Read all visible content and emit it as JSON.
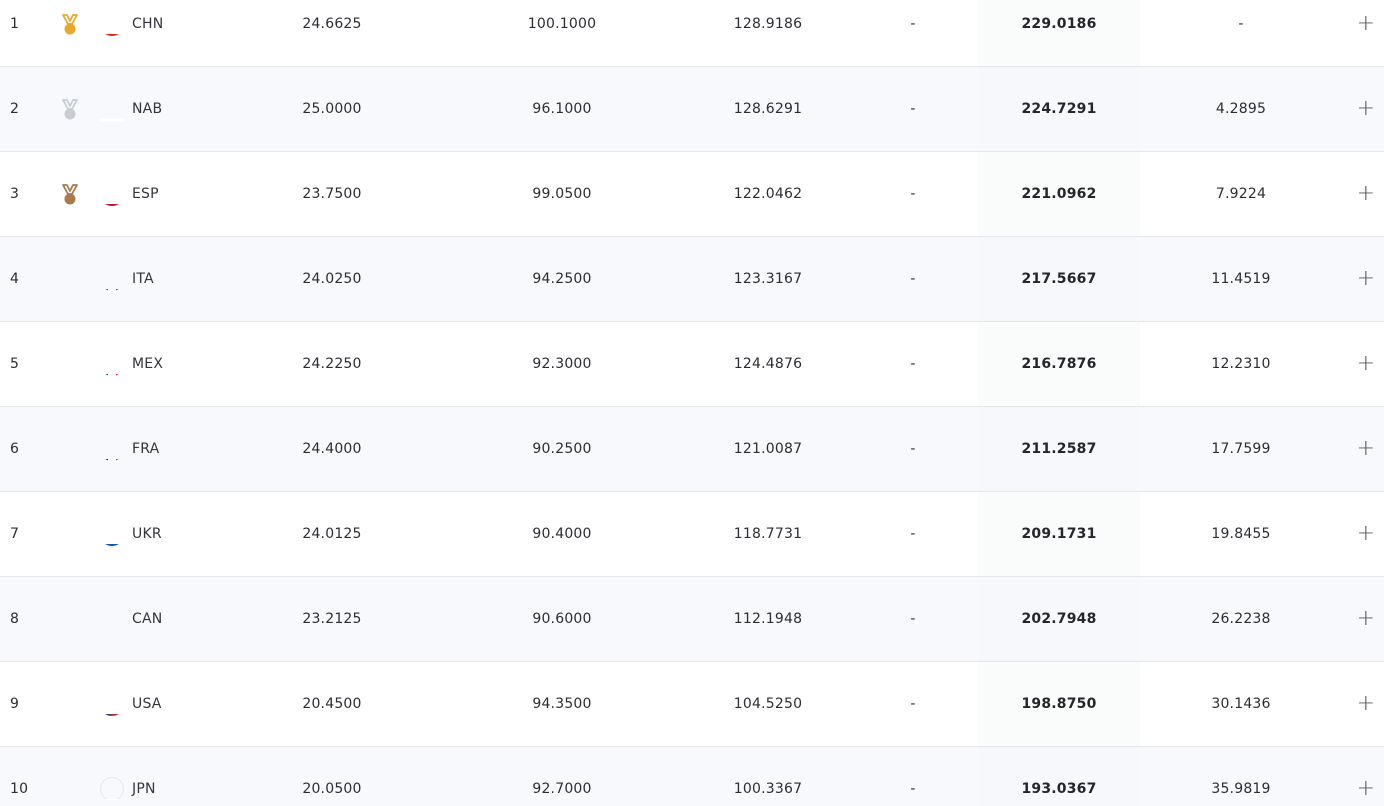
{
  "colors": {
    "gold": "#e9a82a",
    "silver": "#c9ccd1",
    "bronze": "#a87b4d",
    "row_alt": "#f6f8fb",
    "total_band": "#f4f5f7",
    "divider": "#e4e6ea"
  },
  "rows": [
    {
      "rank": "1",
      "medal": "gold-medal-icon",
      "flag": "china-flag-icon",
      "country": "CHN",
      "col1": "24.6625",
      "col2": "100.1000",
      "col3": "128.9186",
      "col4": "-",
      "total": "229.0186",
      "gap": "-",
      "expand": "+"
    },
    {
      "rank": "2",
      "medal": "silver-medal-icon",
      "flag": "neutral-athletes-flag-icon",
      "country": "NAB",
      "col1": "25.0000",
      "col2": "96.1000",
      "col3": "128.6291",
      "col4": "-",
      "total": "224.7291",
      "gap": "4.2895",
      "expand": "+"
    },
    {
      "rank": "3",
      "medal": "bronze-medal-icon",
      "flag": "spain-flag-icon",
      "country": "ESP",
      "col1": "23.7500",
      "col2": "99.0500",
      "col3": "122.0462",
      "col4": "-",
      "total": "221.0962",
      "gap": "7.9224",
      "expand": "+"
    },
    {
      "rank": "4",
      "medal": "",
      "flag": "italy-flag-icon",
      "country": "ITA",
      "col1": "24.0250",
      "col2": "94.2500",
      "col3": "123.3167",
      "col4": "-",
      "total": "217.5667",
      "gap": "11.4519",
      "expand": "+"
    },
    {
      "rank": "5",
      "medal": "",
      "flag": "mexico-flag-icon",
      "country": "MEX",
      "col1": "24.2250",
      "col2": "92.3000",
      "col3": "124.4876",
      "col4": "-",
      "total": "216.7876",
      "gap": "12.2310",
      "expand": "+"
    },
    {
      "rank": "6",
      "medal": "",
      "flag": "france-flag-icon",
      "country": "FRA",
      "col1": "24.4000",
      "col2": "90.2500",
      "col3": "121.0087",
      "col4": "-",
      "total": "211.2587",
      "gap": "17.7599",
      "expand": "+"
    },
    {
      "rank": "7",
      "medal": "",
      "flag": "ukraine-flag-icon",
      "country": "UKR",
      "col1": "24.0125",
      "col2": "90.4000",
      "col3": "118.7731",
      "col4": "-",
      "total": "209.1731",
      "gap": "19.8455",
      "expand": "+"
    },
    {
      "rank": "8",
      "medal": "",
      "flag": "canada-flag-icon",
      "country": "CAN",
      "col1": "23.2125",
      "col2": "90.6000",
      "col3": "112.1948",
      "col4": "-",
      "total": "202.7948",
      "gap": "26.2238",
      "expand": "+"
    },
    {
      "rank": "9",
      "medal": "",
      "flag": "usa-flag-icon",
      "country": "USA",
      "col1": "20.4500",
      "col2": "94.3500",
      "col3": "104.5250",
      "col4": "-",
      "total": "198.8750",
      "gap": "30.1436",
      "expand": "+"
    },
    {
      "rank": "10",
      "medal": "",
      "flag": "japan-flag-icon",
      "country": "JPN",
      "col1": "20.0500",
      "col2": "92.7000",
      "col3": "100.3367",
      "col4": "-",
      "total": "193.0367",
      "gap": "35.9819",
      "expand": "+"
    }
  ]
}
